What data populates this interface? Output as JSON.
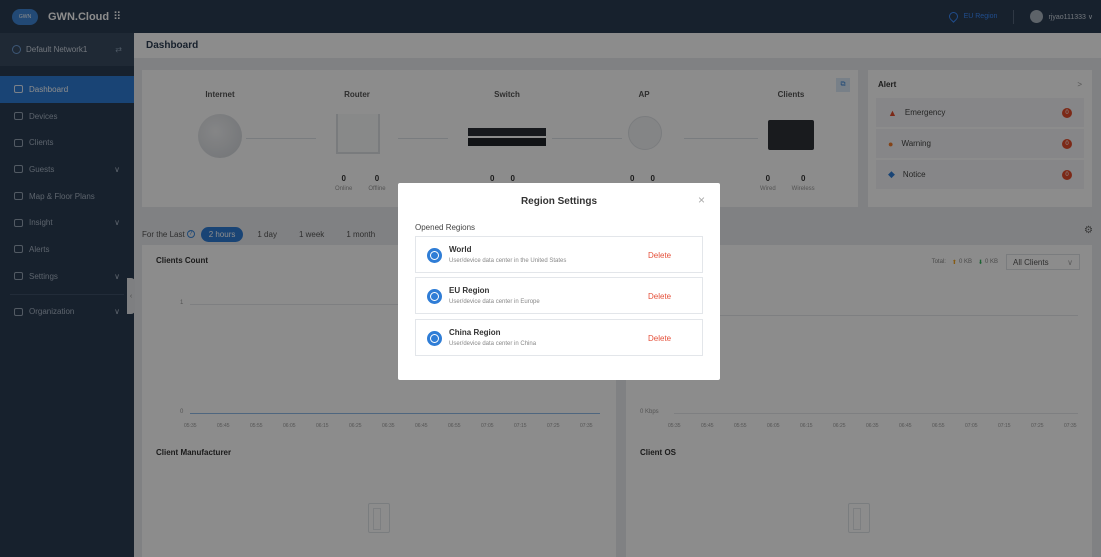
{
  "topbar": {
    "logo": "GWN",
    "brand": "GWN.Cloud",
    "grid_icon": "grid-icon",
    "region": "EU Region",
    "user": "rjyao111333 ∨"
  },
  "sidebar": {
    "network": "Default Network1",
    "items": [
      {
        "label": "Dashboard",
        "icon": "dashboard-icon",
        "active": true
      },
      {
        "label": "Devices",
        "icon": "devices-icon"
      },
      {
        "label": "Clients",
        "icon": "clients-icon"
      },
      {
        "label": "Guests",
        "icon": "guests-icon",
        "chevron": "∨"
      },
      {
        "label": "Map & Floor Plans",
        "icon": "map-icon"
      },
      {
        "label": "Insight",
        "icon": "insight-icon",
        "chevron": "∨"
      },
      {
        "label": "Alerts",
        "icon": "bell-icon"
      },
      {
        "label": "Settings",
        "icon": "settings-icon",
        "chevron": "∨"
      },
      {
        "label": "Organization",
        "icon": "organization-icon",
        "chevron": "∨"
      }
    ]
  },
  "main": {
    "title": "Dashboard",
    "topology": {
      "nodes": [
        {
          "label": "Internet"
        },
        {
          "label": "Router",
          "stats": [
            {
              "value": "0",
              "label": "Online"
            },
            {
              "value": "0",
              "label": "Offline"
            }
          ]
        },
        {
          "label": "Switch",
          "stats": [
            {
              "value": "0",
              "label": ""
            },
            {
              "value": "0",
              "label": ""
            }
          ]
        },
        {
          "label": "AP",
          "stats": [
            {
              "value": "0",
              "label": ""
            },
            {
              "value": "0",
              "label": ""
            }
          ]
        },
        {
          "label": "Clients",
          "stats": [
            {
              "value": "0",
              "label": "Wired"
            },
            {
              "value": "0",
              "label": "Wireless"
            }
          ]
        }
      ]
    },
    "alert": {
      "title": "Alert",
      "chevron": ">",
      "items": [
        {
          "label": "Emergency",
          "count": "0",
          "icon": "emergency-icon",
          "color": "#e24b2b"
        },
        {
          "label": "Warning",
          "count": "0",
          "icon": "warning-icon",
          "color": "#f07a2a"
        },
        {
          "label": "Notice",
          "count": "0",
          "icon": "notice-icon",
          "color": "#2f7dd6"
        }
      ]
    },
    "filter": {
      "label": "For the Last",
      "tabs": [
        "2 hours",
        "1 day",
        "1 week",
        "1 month"
      ],
      "active_tab": "2 hours"
    },
    "clients_count": {
      "title": "Clients Count",
      "y_ticks": [
        "1",
        "0"
      ],
      "x_ticks": [
        "05:35",
        "05:45",
        "05:55",
        "06:05",
        "06:15",
        "06:25",
        "06:35",
        "06:45",
        "06:55",
        "07:05",
        "07:15",
        "07:25",
        "07:35"
      ]
    },
    "traffic": {
      "total_label": "Total:",
      "up": "0 KB",
      "down": "0 KB",
      "select_value": "All Clients",
      "y_ticks": [
        "0 Kbps"
      ],
      "x_ticks": [
        "05:35",
        "05:45",
        "05:55",
        "06:05",
        "06:15",
        "06:25",
        "06:35",
        "06:45",
        "06:55",
        "07:05",
        "07:15",
        "07:25",
        "07:35"
      ]
    },
    "client_manufacturer": {
      "title": "Client Manufacturer"
    },
    "client_os": {
      "title": "Client OS"
    }
  },
  "modal": {
    "title": "Region Settings",
    "close": "×",
    "subtitle": "Opened Regions",
    "regions": [
      {
        "name": "World",
        "desc": "User/device data center in the United States",
        "action": "Delete"
      },
      {
        "name": "EU Region",
        "desc": "User/device data center in Europe",
        "action": "Delete"
      },
      {
        "name": "China Region",
        "desc": "User/device data center in China",
        "action": "Delete"
      }
    ]
  }
}
